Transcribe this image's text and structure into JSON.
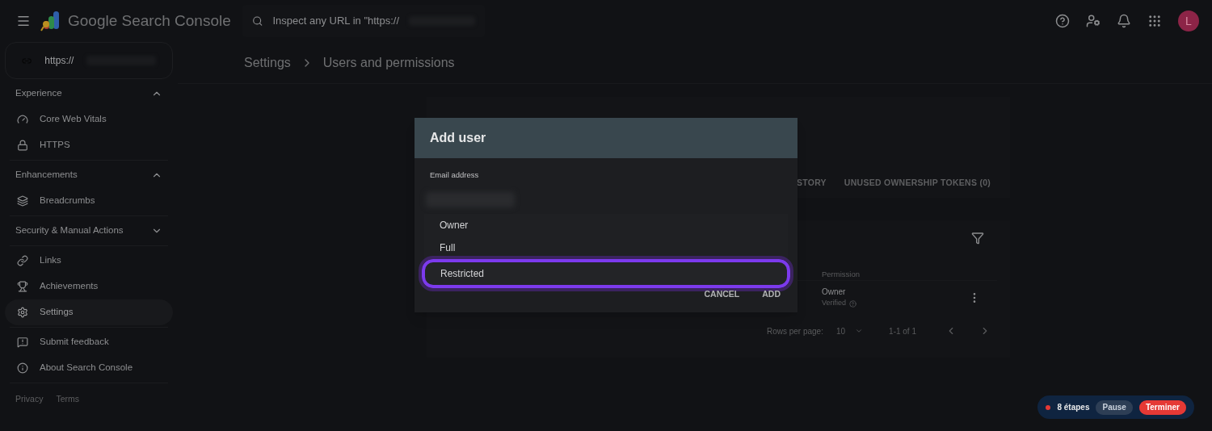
{
  "header": {
    "product": "Google Search Console",
    "search_placeholder": "Inspect any URL in \"https://",
    "avatar": "L"
  },
  "property": {
    "url": "https://"
  },
  "sidebar": {
    "sections": [
      {
        "title": "Experience",
        "expanded": true,
        "items": [
          {
            "label": "Core Web Vitals",
            "kind": "gauge",
            "selected": false
          },
          {
            "label": "HTTPS",
            "kind": "lock",
            "selected": false
          }
        ]
      },
      {
        "title": "Enhancements",
        "expanded": true,
        "items": [
          {
            "label": "Breadcrumbs",
            "kind": "layers",
            "selected": false
          }
        ]
      },
      {
        "title": "Security & Manual Actions",
        "expanded": false
      },
      {
        "items": [
          {
            "label": "Links",
            "kind": "link",
            "selected": false
          },
          {
            "label": "Achievements",
            "kind": "trophy",
            "selected": false
          },
          {
            "label": "Settings",
            "kind": "gear",
            "selected": true
          }
        ]
      },
      {
        "items": [
          {
            "label": "Submit feedback",
            "kind": "feedback",
            "selected": false
          },
          {
            "label": "About Search Console",
            "kind": "info",
            "selected": false
          }
        ]
      }
    ],
    "footer": [
      "Privacy",
      "Terms"
    ]
  },
  "breadcrumb": [
    "Settings",
    "Users and permissions"
  ],
  "tabs": [
    {
      "label": "STORY",
      "selected": false
    },
    {
      "label": "UNUSED OWNERSHIP TOKENS (0)",
      "selected": false
    }
  ],
  "table": {
    "column": "Permission",
    "rows": [
      {
        "permission": "Owner",
        "status": "Verified"
      }
    ],
    "rows_per_page_label": "Rows per page:",
    "rows_per_page": "10",
    "range": "1-1 of 1"
  },
  "dialog": {
    "title": "Add user",
    "field_label": "Email address",
    "options": [
      {
        "label": "Owner",
        "selected": false
      },
      {
        "label": "Full",
        "selected": false
      },
      {
        "label": "Restricted",
        "selected": true
      }
    ],
    "buttons": [
      "CANCEL",
      "ADD"
    ]
  },
  "recorder": {
    "steps": "8 étapes",
    "pause": "Pause",
    "finish": "Terminer"
  }
}
